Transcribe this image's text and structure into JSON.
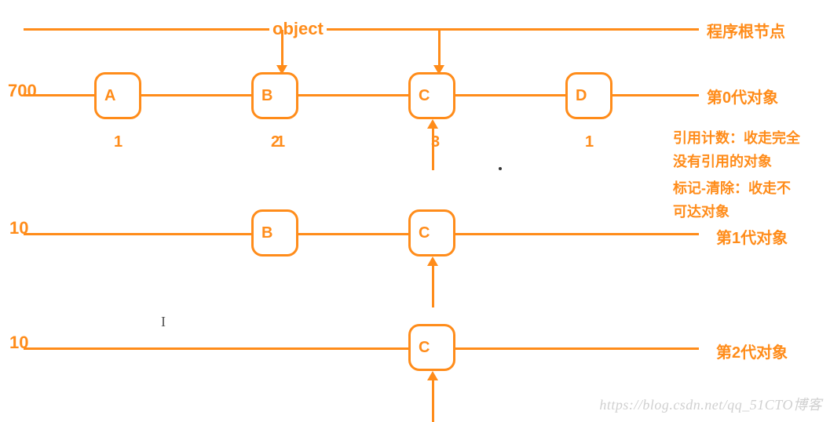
{
  "headers": {
    "object": "object",
    "root": "程序根节点"
  },
  "generations": [
    {
      "threshold": "700",
      "label": "第0代对象",
      "boxes": [
        {
          "letter": "A",
          "count": "1"
        },
        {
          "letter": "B",
          "count": "2"
        },
        {
          "letter": "C",
          "count": "3"
        },
        {
          "letter": "D",
          "count": "1"
        }
      ]
    },
    {
      "threshold": "10",
      "label": "第1代对象",
      "boxes": [
        {
          "letter": "B"
        },
        {
          "letter": "C"
        }
      ]
    },
    {
      "threshold": "10",
      "label": "第2代对象",
      "boxes": [
        {
          "letter": "C"
        }
      ]
    }
  ],
  "notes": {
    "line1": "引用计数：收走完全",
    "line2": "没有引用的对象",
    "line3": "标记-清除：收走不",
    "line4": "可达对象"
  },
  "watermark": "https://blog.csdn.net/qq_51CTO博客"
}
